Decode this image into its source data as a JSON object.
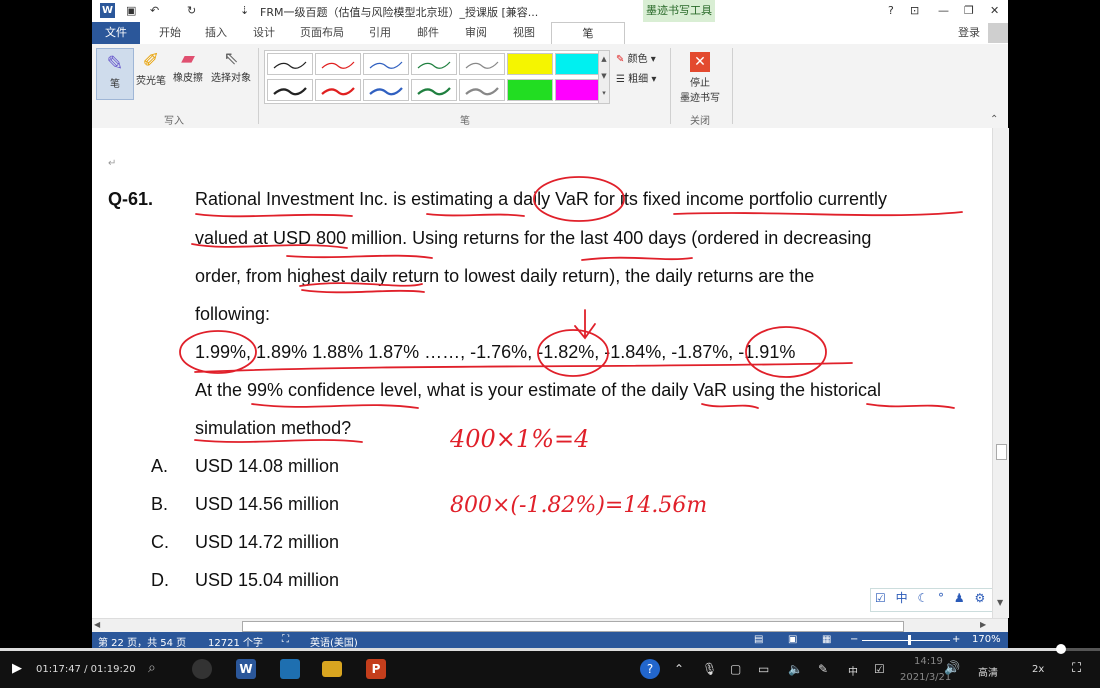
{
  "titlebar": {
    "title": "FRM一级百题（估值与风险模型北京班）_授课版 [兼容...",
    "context_tab": "墨迹书写工具",
    "help": "?"
  },
  "tabs": [
    "文件",
    "开始",
    "插入",
    "设计",
    "页面布局",
    "引用",
    "邮件",
    "审阅",
    "视图",
    "笔"
  ],
  "login": "登录",
  "ribbon": {
    "pen": "笔",
    "highlighter": "荧光笔",
    "eraser": "橡皮擦",
    "select": "选择对象",
    "group_write": "写入",
    "group_pen": "笔",
    "color": "颜色",
    "weight": "粗细",
    "stop_line1": "停止",
    "stop_line2": "墨迹书写",
    "group_close": "关闭"
  },
  "document": {
    "question_no": "Q-61.",
    "lines": [
      "Rational Investment Inc. is estimating a daily VaR for its fixed income portfolio currently",
      "valued at USD 800 million. Using returns for the last 400 days (ordered in decreasing",
      "order, from highest daily return to lowest daily return), the daily returns are the",
      "following:",
      "1.99%, 1.89% 1.88% 1.87% ……, -1.76%, -1.82%, -1.84%, -1.87%, -1.91%",
      "At the 99% confidence level, what is your estimate of the daily VaR using the historical",
      "simulation method?"
    ],
    "options": [
      {
        "letter": "A.",
        "text": "USD 14.08 million"
      },
      {
        "letter": "B.",
        "text": "USD 14.56 million"
      },
      {
        "letter": "C.",
        "text": "USD 14.72 million"
      },
      {
        "letter": "D.",
        "text": "USD 15.04 million"
      }
    ],
    "handwriting_1": "400×1%=4",
    "handwriting_2": "800×(-1.82%)=14.56m",
    "ink_color": "#e0202a"
  },
  "ime_bar": [
    "中"
  ],
  "statusbar": {
    "page": "第 22 页，共 54 页",
    "words": "12721 个字",
    "language": "英语(美国)",
    "zoom": "170%"
  },
  "player": {
    "time": "01:17:47 / 01:19:20",
    "progress": 0.965,
    "clock_time": "14:19",
    "clock_date": "2021/3/21",
    "quality": "高清",
    "speed": "2x",
    "tray_ime": "中"
  },
  "colors": {
    "accent": "#2b579a",
    "highlight_yellow": "#f5f500",
    "highlight_cyan": "#00f0f0",
    "highlight_green": "#22dd22",
    "highlight_magenta": "#ff00ff",
    "stop_red": "#e34a2f"
  }
}
